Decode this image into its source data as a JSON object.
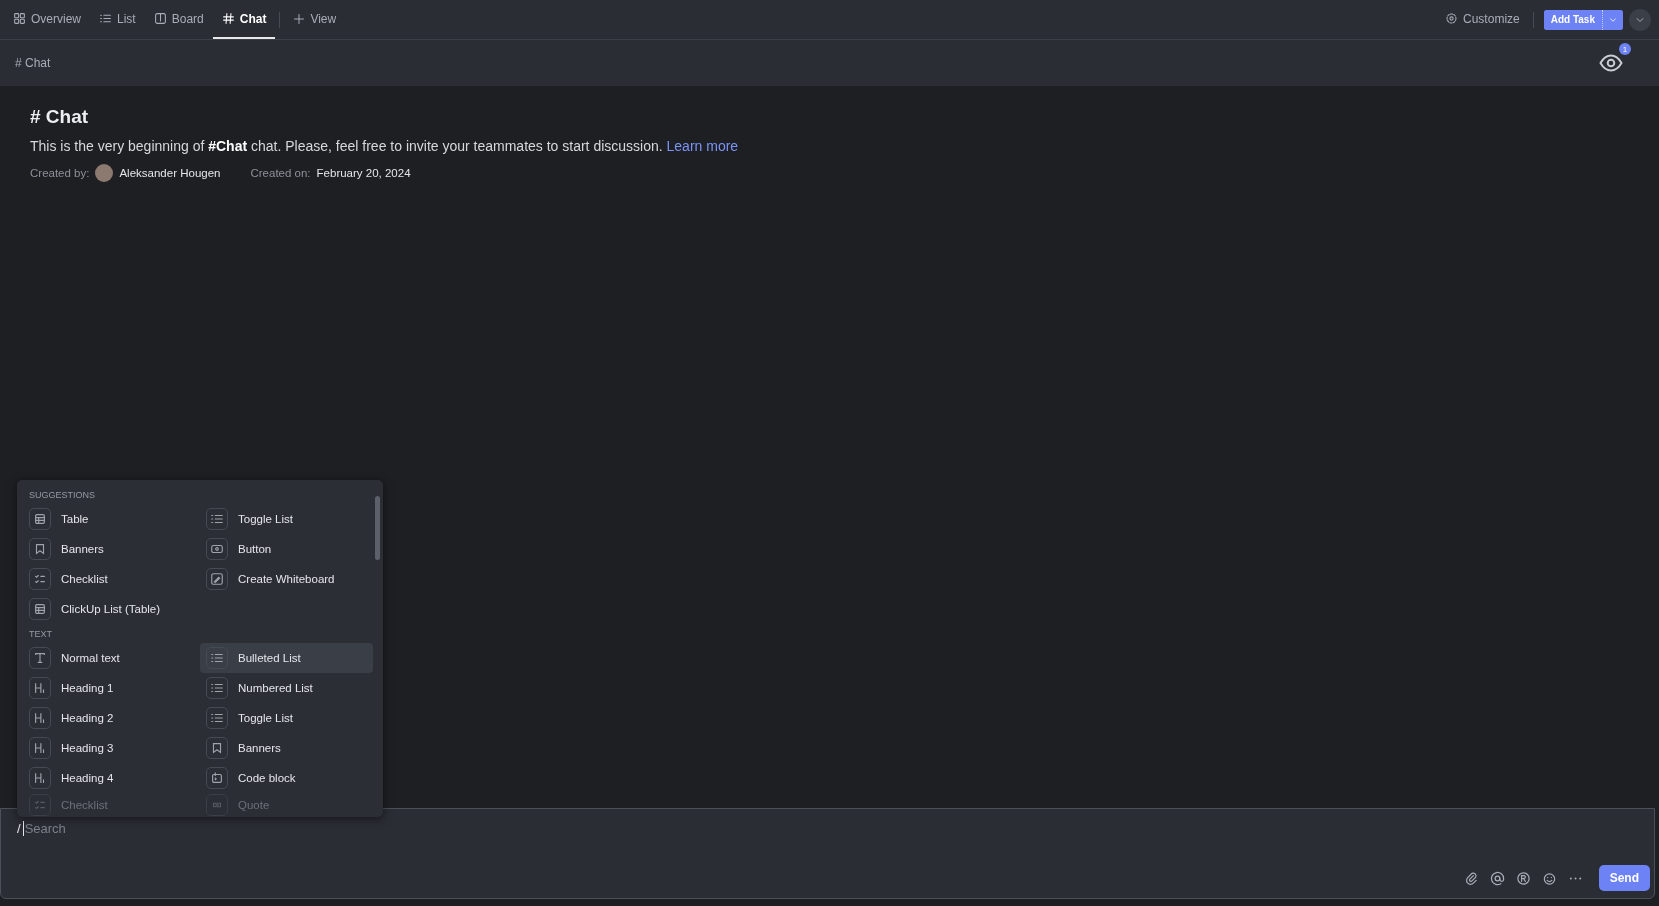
{
  "tabs": [
    {
      "kind": "grid",
      "label": "Overview",
      "selected": false
    },
    {
      "kind": "list",
      "label": "List",
      "selected": false
    },
    {
      "kind": "board",
      "label": "Board",
      "selected": false
    },
    {
      "kind": "hash",
      "label": "Chat",
      "selected": true
    }
  ],
  "add_view": "View",
  "customize": "Customize",
  "add_task": "Add Task",
  "header": {
    "title": "# Chat",
    "watcher_count": "1"
  },
  "intro": {
    "title": "# Chat",
    "text": "This is the very beginning of **#Chat** chat. Please, feel free to invite your teammates to start discussion.",
    "link": "Learn more",
    "created_by_label": "Created by:",
    "creator": "Aleksander Hougen",
    "created_on_label": "Created on:",
    "created_on": "February 20, 2024"
  },
  "menu": {
    "sections": [
      {
        "title": "SUGGESTIONS",
        "items": [
          {
            "kind": "table",
            "label": "Table",
            "selected": false,
            "faded": false
          },
          {
            "kind": "list",
            "label": "Toggle List",
            "selected": false,
            "faded": false
          },
          {
            "kind": "banner",
            "label": "Banners",
            "selected": false,
            "faded": false
          },
          {
            "kind": "button",
            "label": "Button",
            "selected": false,
            "faded": false
          },
          {
            "kind": "checklist",
            "label": "Checklist",
            "selected": false,
            "faded": false
          },
          {
            "kind": "whiteboard",
            "label": "Create Whiteboard",
            "selected": false,
            "faded": false
          },
          {
            "kind": "table",
            "label": "ClickUp List (Table)",
            "selected": false,
            "faded": false
          }
        ]
      },
      {
        "title": "TEXT",
        "items": [
          {
            "kind": "text",
            "label": "Normal text",
            "selected": false,
            "faded": false
          },
          {
            "kind": "list",
            "label": "Bulleted List",
            "selected": true,
            "faded": false
          },
          {
            "kind": "heading",
            "label": "Heading 1",
            "selected": false,
            "faded": false
          },
          {
            "kind": "list",
            "label": "Numbered List",
            "selected": false,
            "faded": false
          },
          {
            "kind": "heading",
            "label": "Heading 2",
            "selected": false,
            "faded": false
          },
          {
            "kind": "list",
            "label": "Toggle List",
            "selected": false,
            "faded": false
          },
          {
            "kind": "heading",
            "label": "Heading 3",
            "selected": false,
            "faded": false
          },
          {
            "kind": "banner",
            "label": "Banners",
            "selected": false,
            "faded": false
          },
          {
            "kind": "heading",
            "label": "Heading 4",
            "selected": false,
            "faded": false
          },
          {
            "kind": "code",
            "label": "Code block",
            "selected": false,
            "faded": false
          },
          {
            "kind": "checklist",
            "label": "Checklist",
            "selected": false,
            "faded": true
          },
          {
            "kind": "quote",
            "label": "Quote",
            "selected": false,
            "faded": true
          }
        ]
      }
    ]
  },
  "composer": {
    "prefix": "/",
    "placeholder": "Search",
    "send": "Send"
  }
}
